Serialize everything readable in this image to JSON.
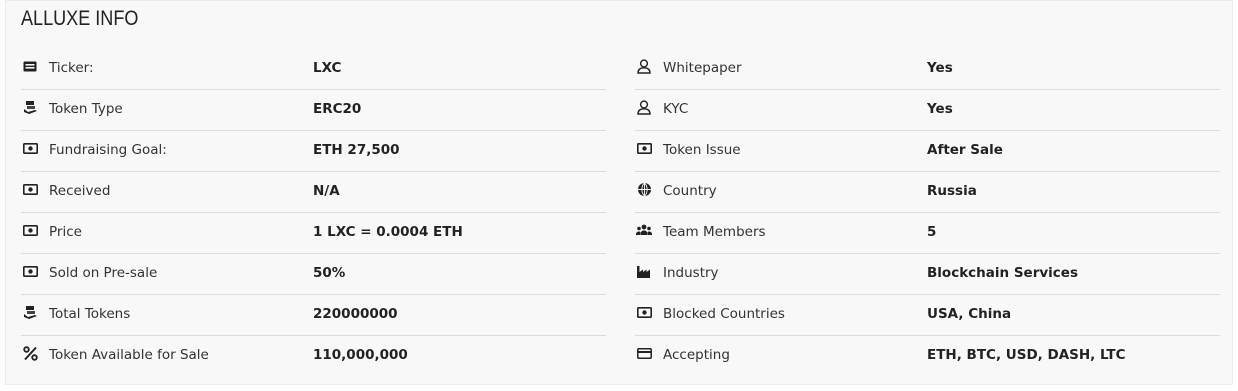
{
  "title": "ALLUXE INFO",
  "left": [
    {
      "icon": "ticket-icon",
      "label": "Ticker:",
      "value": "LXC"
    },
    {
      "icon": "money-hand-icon",
      "label": "Token Type",
      "value": "ERC20"
    },
    {
      "icon": "banknote-icon",
      "label": "Fundraising Goal:",
      "value": "ETH 27,500"
    },
    {
      "icon": "banknote-icon",
      "label": "Received",
      "value": "N/A"
    },
    {
      "icon": "banknote-icon",
      "label": "Price",
      "value": "1 LXC = 0.0004 ETH"
    },
    {
      "icon": "banknote-icon",
      "label": "Sold on Pre-sale",
      "value": "50%"
    },
    {
      "icon": "money-hand-icon",
      "label": "Total Tokens",
      "value": "220000000"
    },
    {
      "icon": "percent-icon",
      "label": "Token Available for Sale",
      "value": "110,000,000"
    }
  ],
  "right": [
    {
      "icon": "user-icon",
      "label": "Whitepaper",
      "value": "Yes"
    },
    {
      "icon": "user-icon",
      "label": "KYC",
      "value": "Yes"
    },
    {
      "icon": "banknote-icon",
      "label": "Token Issue",
      "value": "After Sale"
    },
    {
      "icon": "globe-icon",
      "label": "Country",
      "value": "Russia"
    },
    {
      "icon": "users-icon",
      "label": "Team Members",
      "value": "5"
    },
    {
      "icon": "industry-icon",
      "label": "Industry",
      "value": "Blockchain Services"
    },
    {
      "icon": "banknote-icon",
      "label": "Blocked Countries",
      "value": "USA, China"
    },
    {
      "icon": "credit-card-icon",
      "label": "Accepting",
      "value": "ETH, BTC, USD, DASH, LTC"
    }
  ]
}
